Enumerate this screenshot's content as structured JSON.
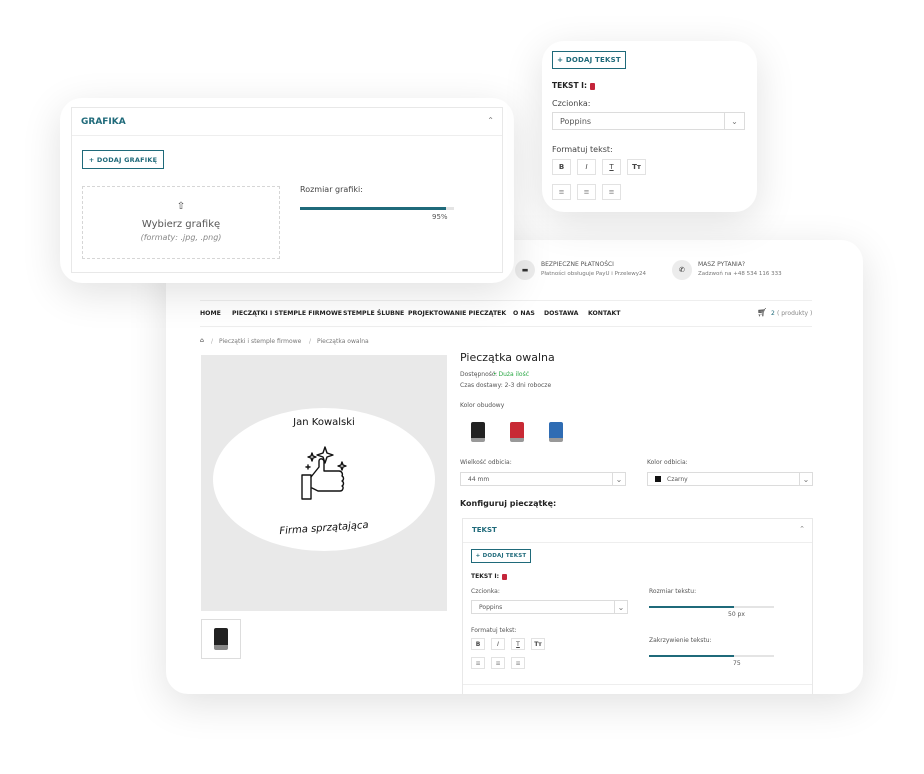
{
  "grafika_card": {
    "header": "GRAFIKA",
    "add_button": "+ DODAJ GRAFIKĘ",
    "upload_title": "Wybierz grafikę",
    "upload_formats": "(formaty: .jpg, .png)",
    "size_label": "Rozmiar grafiki:",
    "size_value_label": "95%",
    "size_value": 0.95
  },
  "text_card": {
    "add_button": "+ DODAJ TEKST",
    "text_label": "TEKST I:",
    "font_label": "Czcionka:",
    "font_value": "Poppins",
    "format_label": "Formatuj tekst:",
    "format_buttons": [
      "B",
      "I",
      "T",
      "Tт"
    ]
  },
  "topbar": {
    "payments_title": "BEZPIECZNE PŁATNOŚCI",
    "payments_sub": "Płatności obsługuje PayU i Przelewy24",
    "questions_title": "MASZ PYTANIA?",
    "questions_sub": "Zadzwoń na +48 534 116 333"
  },
  "nav": {
    "items": [
      "HOME",
      "PIECZĄTKI I STEMPLE FIRMOWE",
      "STEMPLE ŚLUBNE",
      "PROJEKTOWANIE PIECZĄTEK",
      "O NAS",
      "DOSTAWA",
      "KONTAKT"
    ],
    "cart_count": "2",
    "cart_label": "( produkty )"
  },
  "breadcrumb": [
    "Pieczątki i stemple firmowe",
    "Pieczątka owalna"
  ],
  "preview": {
    "top_text": "Jan Kowalski",
    "bottom_text": "Firma sprzątająca"
  },
  "product": {
    "title": "Pieczątka owalna",
    "availability_label": "Dostępność:",
    "availability_value": "• Duża ilość",
    "delivery": "Czas dostawy: 2-3 dni robocze",
    "housing_label": "Kolor obudowy",
    "housing_colors": [
      "#222222",
      "#c82a35",
      "#2f6cb3"
    ],
    "size_label": "Wielkość odbicia:",
    "size_value": "44 mm",
    "color_label": "Kolor odbicia:",
    "color_value": "Czarny",
    "configure_label": "Konfiguruj pieczątkę:",
    "accordion_title": "TEKST",
    "add_text": "+ DODAJ TEKST",
    "text_label": "TEKST I:",
    "font_label": "Czcionka:",
    "font_value": "Poppins",
    "format_label": "Formatuj tekst:",
    "format_buttons": [
      "B",
      "I",
      "T",
      "Tт"
    ],
    "text_size_label": "Rozmiar tekstu:",
    "text_size_value_label": "50 px",
    "text_size_fraction": 0.68,
    "curve_label": "Zakrzywienie tekstu:",
    "curve_value_label": "75",
    "curve_fraction": 0.68
  },
  "colors": {
    "accent": "#1f6a7a",
    "danger": "#c4253a",
    "available": "#2aa845"
  }
}
